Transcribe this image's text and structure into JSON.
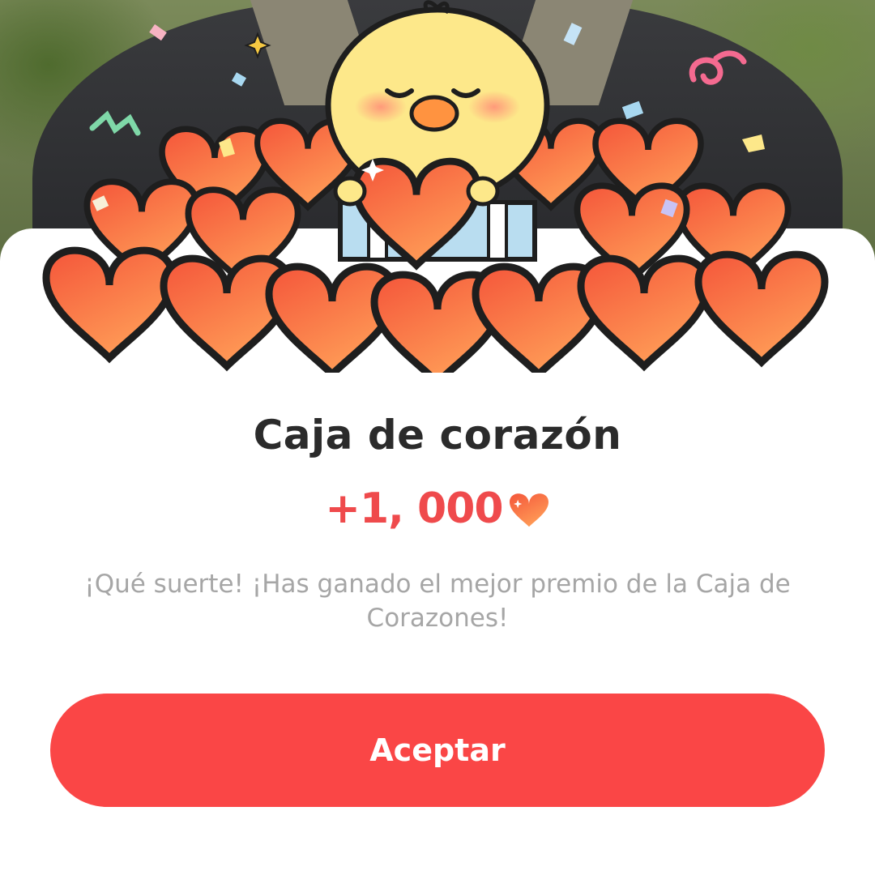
{
  "dialog": {
    "title": "Caja de corazón",
    "reward_amount": "+1, 000",
    "reward_icon": "heart-icon",
    "message": "¡Qué suerte!  ¡Has ganado el mejor premio de la Caja de Corazones!",
    "accept_label": "Aceptar"
  },
  "illustration": {
    "subject": "chick-holding-heart-icon",
    "decor": [
      "heart-pile",
      "confetti",
      "gift-box-icon",
      "sparkle-icon"
    ]
  },
  "colors": {
    "accent": "#fa4646",
    "reward_text": "#ef4a4c",
    "title_text": "#2b2b2b",
    "message_text": "#a6a6a6",
    "heart_top": "#f5643f",
    "heart_bottom": "#ff9a55",
    "chick": "#fde88a"
  }
}
